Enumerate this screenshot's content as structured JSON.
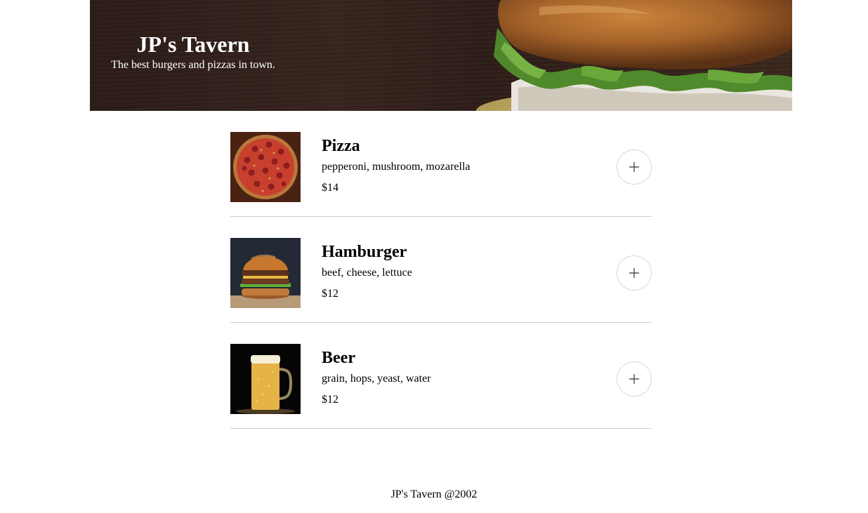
{
  "header": {
    "title": "JP's Tavern",
    "tagline": "The best burgers and pizzas in town."
  },
  "menu": {
    "items": [
      {
        "name": "Pizza",
        "description": "pepperoni, mushroom, mozarella",
        "price": "$14",
        "image": "pizza-image",
        "add_icon": "plus-icon"
      },
      {
        "name": "Hamburger",
        "description": "beef, cheese, lettuce",
        "price": "$12",
        "image": "hamburger-image",
        "add_icon": "plus-icon"
      },
      {
        "name": "Beer",
        "description": "grain, hops, yeast, water",
        "price": "$12",
        "image": "beer-image",
        "add_icon": "plus-icon"
      }
    ]
  },
  "footer": {
    "text": "JP's Tavern @2002"
  },
  "colors": {
    "divider": "#cfcfcf",
    "button_border": "#d6d6d6",
    "hero_background": "#2e1d18",
    "text": "#000000"
  }
}
